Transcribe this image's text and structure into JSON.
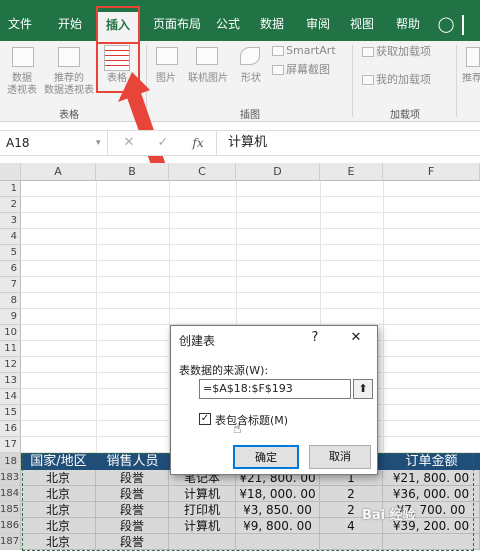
{
  "tabs": [
    "文件",
    "开始",
    "插入",
    "页面布局",
    "公式",
    "数据",
    "审阅",
    "视图",
    "帮助"
  ],
  "ribbon": {
    "pivot_label_1": "数据",
    "pivot_label_2": "透视表",
    "rec_pivot_label_1": "推荐的",
    "rec_pivot_label_2": "数据透视表",
    "table_label": "表格",
    "picture_label": "图片",
    "online_picture_label": "联机图片",
    "shapes_label": "形状",
    "smartart_label": "SmartArt",
    "screenshot_label": "屏幕截图",
    "get_addins_label": "获取加载项",
    "my_addins_label": "我的加载项",
    "group_tables": "表格",
    "group_illustrations": "插图",
    "group_addins": "加载项",
    "right_partial_label": "推荐"
  },
  "formula_bar": {
    "name_box": "A18",
    "fx": "fx",
    "content": "计算机"
  },
  "columns": [
    "A",
    "B",
    "C",
    "D",
    "E",
    "F"
  ],
  "row_numbers": [
    "1",
    "2",
    "3",
    "4",
    "5",
    "6",
    "7",
    "8",
    "9",
    "10",
    "11",
    "12",
    "13",
    "14",
    "15",
    "16",
    "17",
    "18",
    "183",
    "184",
    "185",
    "186",
    "187"
  ],
  "table_header": [
    "国家/地区",
    "销售人员",
    "",
    "",
    "",
    "订单金额"
  ],
  "rows": [
    [
      "北京",
      "段誉",
      "笔记本",
      "¥21, 800. 00",
      "1",
      "¥21, 800. 00"
    ],
    [
      "北京",
      "段誉",
      "计算机",
      "¥18, 000. 00",
      "2",
      "¥36, 000. 00"
    ],
    [
      "北京",
      "段誉",
      "打印机",
      "¥3, 850. 00",
      "2",
      "¥7, 700. 00"
    ],
    [
      "北京",
      "段誉",
      "计算机",
      "¥9, 800. 00",
      "4",
      "¥39, 200. 00"
    ],
    [
      "北京",
      "段誉",
      "",
      "",
      "",
      ""
    ]
  ],
  "dialog": {
    "title": "创建表",
    "help": "?",
    "close": "✕",
    "source_label": "表数据的来源(W):",
    "range_value": "=$A$18:$F$193",
    "header_checkbox_label": "表包含标题(M)",
    "header_checked": true,
    "ok": "确定",
    "cancel": "取消"
  },
  "watermark": "Bai 经验",
  "colors": {
    "excel_green": "#217346",
    "highlight_red": "#e8443a",
    "table_header_blue": "#1f4e79"
  }
}
